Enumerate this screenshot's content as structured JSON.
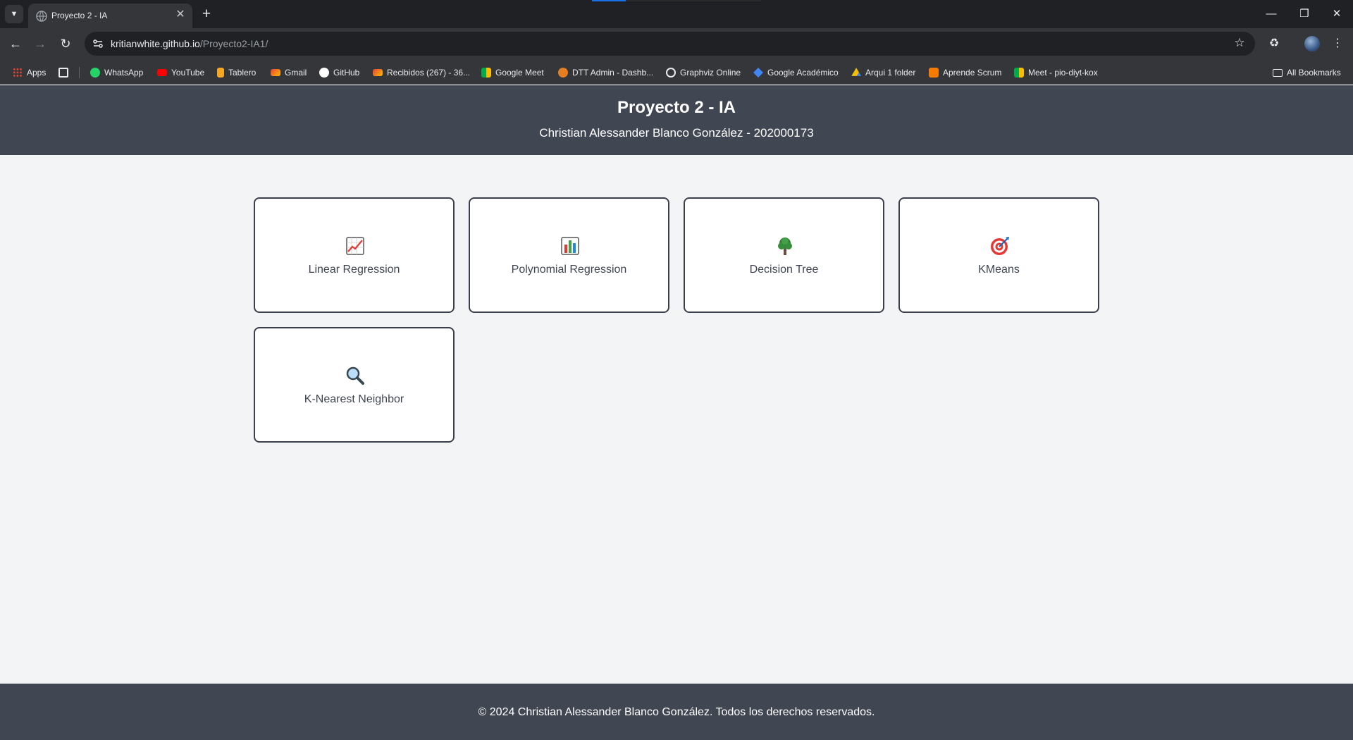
{
  "browser": {
    "tab": {
      "title": "Proyecto 2 - IA"
    },
    "url": {
      "host": "kritianwhite.github.io",
      "path": "/Proyecto2-IA1/"
    },
    "bookmarks": [
      {
        "label": "Apps",
        "icon": "apps-grid-icon"
      },
      {
        "label": "WhatsApp",
        "icon": "whatsapp-icon",
        "color": "#25d366"
      },
      {
        "label": "YouTube",
        "icon": "youtube-icon",
        "color": "#ff0000"
      },
      {
        "label": "Tablero",
        "icon": "tablero-icon",
        "color": "#f5a623"
      },
      {
        "label": "Gmail",
        "icon": "gmail-icon",
        "color": "#ea4335"
      },
      {
        "label": "GitHub",
        "icon": "github-icon",
        "color": "#ffffff"
      },
      {
        "label": "Recibidos (267) - 36...",
        "icon": "gmail-icon",
        "color": "#ea4335"
      },
      {
        "label": "Google Meet",
        "icon": "meet-icon",
        "color": "#00ac47"
      },
      {
        "label": "DTT Admin - Dashb...",
        "icon": "dtt-icon",
        "color": "#e67e22"
      },
      {
        "label": "Graphviz Online",
        "icon": "globe-icon",
        "color": "#e8eaed"
      },
      {
        "label": "Google Académico",
        "icon": "scholar-icon",
        "color": "#4285f4"
      },
      {
        "label": "Arqui 1 folder",
        "icon": "drive-icon",
        "color": "#fbbc04"
      },
      {
        "label": "Aprende Scrum",
        "icon": "scrum-icon",
        "color": "#f57c00"
      },
      {
        "label": "Meet - pio-diyt-kox",
        "icon": "meet-icon",
        "color": "#00ac47"
      }
    ],
    "all_bookmarks": "All Bookmarks"
  },
  "header": {
    "title": "Proyecto 2 - IA",
    "subtitle": "Christian Alessander Blanco González - 202000173"
  },
  "algorithms": [
    {
      "label": "Linear Regression",
      "icon": "chart-increasing-icon"
    },
    {
      "label": "Polynomial Regression",
      "icon": "bar-chart-icon"
    },
    {
      "label": "Decision Tree",
      "icon": "tree-icon"
    },
    {
      "label": "KMeans",
      "icon": "target-icon"
    },
    {
      "label": "K-Nearest Neighbor",
      "icon": "magnifier-icon"
    }
  ],
  "footer": {
    "text": "© 2024 Christian Alessander Blanco González. Todos los derechos reservados."
  }
}
